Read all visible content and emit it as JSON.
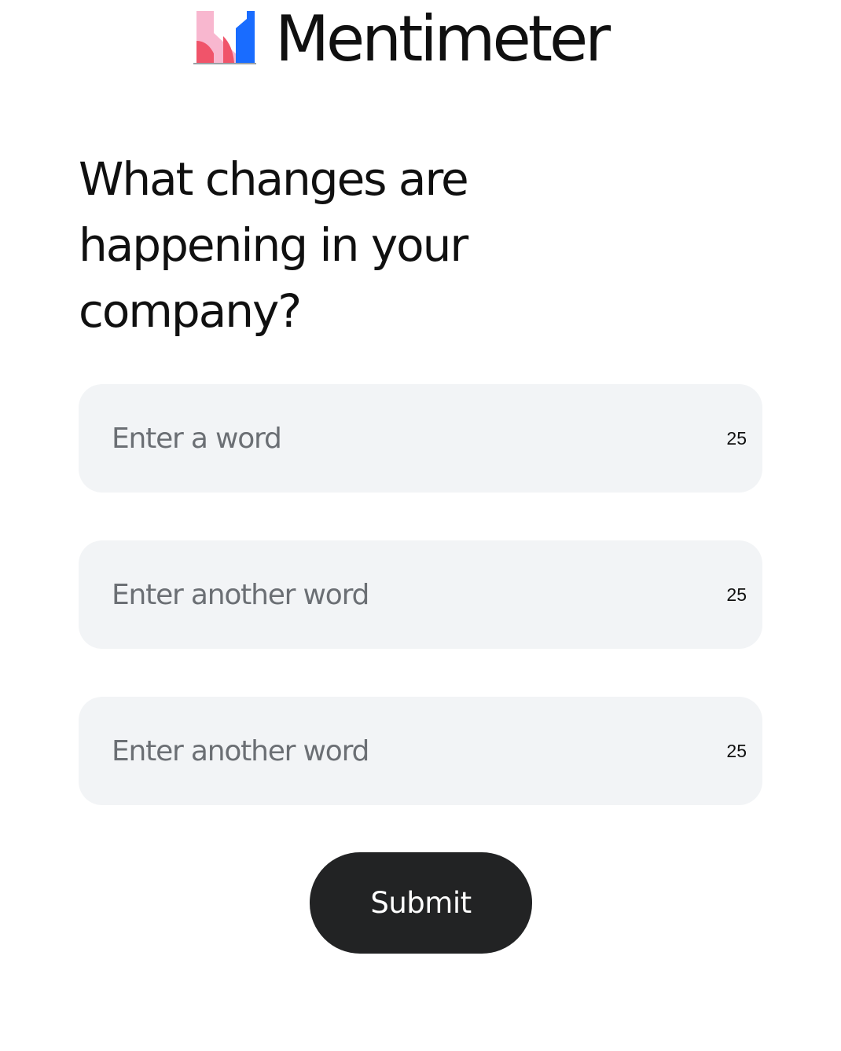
{
  "brand": {
    "name": "Mentimeter",
    "logo_icon": "mentimeter-logo-icon",
    "colors": {
      "pink": "#f8b7cf",
      "red": "#f0546a",
      "blue": "#196cff"
    }
  },
  "question": {
    "text": "What changes are happening in your company?"
  },
  "fields": [
    {
      "placeholder": "Enter a word",
      "value": "",
      "remaining": "25"
    },
    {
      "placeholder": "Enter another word",
      "value": "",
      "remaining": "25"
    },
    {
      "placeholder": "Enter another word",
      "value": "",
      "remaining": "25"
    }
  ],
  "submit": {
    "label": "Submit"
  },
  "colors": {
    "field_background": "#f2f4f6",
    "button_background": "#222324",
    "text": "#101010",
    "placeholder": "#6b6f74"
  }
}
